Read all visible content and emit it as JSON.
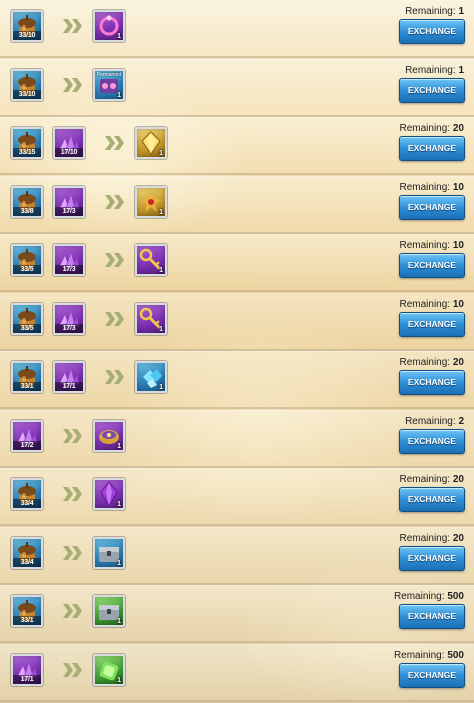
{
  "remaining_label": "Remaining:",
  "exchange_label": "EXCHANGE",
  "rows": [
    {
      "inputs": [
        {
          "icon": "acorn-icon",
          "tier": "blue",
          "qty": "33/10"
        }
      ],
      "output": {
        "icon": "pink-ring-icon",
        "tier": "purple",
        "count": "1"
      },
      "remaining": "1"
    },
    {
      "inputs": [
        {
          "icon": "acorn-icon",
          "tier": "blue",
          "qty": "33/10"
        }
      ],
      "output": {
        "icon": "permanent-item-icon",
        "tier": "blue",
        "count": "1",
        "caption": "Permanent"
      },
      "remaining": "1"
    },
    {
      "inputs": [
        {
          "icon": "acorn-icon",
          "tier": "blue",
          "qty": "33/15"
        },
        {
          "icon": "purple-shards-icon",
          "tier": "purple",
          "qty": "17/10"
        }
      ],
      "output": {
        "icon": "gold-crystal-icon",
        "tier": "gold",
        "count": "1"
      },
      "remaining": "20"
    },
    {
      "inputs": [
        {
          "icon": "acorn-icon",
          "tier": "blue",
          "qty": "33/8"
        },
        {
          "icon": "purple-shards-icon",
          "tier": "purple",
          "qty": "17/3"
        }
      ],
      "output": {
        "icon": "gold-scroll-icon",
        "tier": "gold",
        "count": "1"
      },
      "remaining": "10"
    },
    {
      "inputs": [
        {
          "icon": "acorn-icon",
          "tier": "blue",
          "qty": "33/5"
        },
        {
          "icon": "purple-shards-icon",
          "tier": "purple",
          "qty": "17/3"
        }
      ],
      "output": {
        "icon": "gold-key-icon",
        "tier": "purple",
        "count": "1"
      },
      "remaining": "10"
    },
    {
      "inputs": [
        {
          "icon": "acorn-icon",
          "tier": "blue",
          "qty": "33/5"
        },
        {
          "icon": "purple-shards-icon",
          "tier": "purple",
          "qty": "17/3"
        }
      ],
      "output": {
        "icon": "gold-key-icon",
        "tier": "purple",
        "count": "1"
      },
      "remaining": "10"
    },
    {
      "inputs": [
        {
          "icon": "acorn-icon",
          "tier": "blue",
          "qty": "33/1"
        },
        {
          "icon": "purple-shards-icon",
          "tier": "purple",
          "qty": "17/1"
        }
      ],
      "output": {
        "icon": "blue-gems-icon",
        "tier": "blue",
        "count": "1"
      },
      "remaining": "20"
    },
    {
      "inputs": [
        {
          "icon": "purple-shards-icon",
          "tier": "purple",
          "qty": "17/2"
        }
      ],
      "output": {
        "icon": "gold-chest-icon",
        "tier": "purple",
        "count": "1"
      },
      "remaining": "2"
    },
    {
      "inputs": [
        {
          "icon": "acorn-icon",
          "tier": "blue",
          "qty": "33/4"
        }
      ],
      "output": {
        "icon": "purple-crystal-icon",
        "tier": "purple",
        "count": "1"
      },
      "remaining": "20"
    },
    {
      "inputs": [
        {
          "icon": "acorn-icon",
          "tier": "blue",
          "qty": "33/4"
        }
      ],
      "output": {
        "icon": "silver-chest-icon",
        "tier": "blue",
        "count": "1"
      },
      "remaining": "20"
    },
    {
      "inputs": [
        {
          "icon": "acorn-icon",
          "tier": "blue",
          "qty": "33/1"
        }
      ],
      "output": {
        "icon": "silver-chest-icon",
        "tier": "green",
        "count": "1"
      },
      "remaining": "500"
    },
    {
      "inputs": [
        {
          "icon": "purple-shards-icon",
          "tier": "purple",
          "qty": "17/1"
        }
      ],
      "output": {
        "icon": "green-token-icon",
        "tier": "green",
        "count": "1"
      },
      "remaining": "500"
    }
  ]
}
